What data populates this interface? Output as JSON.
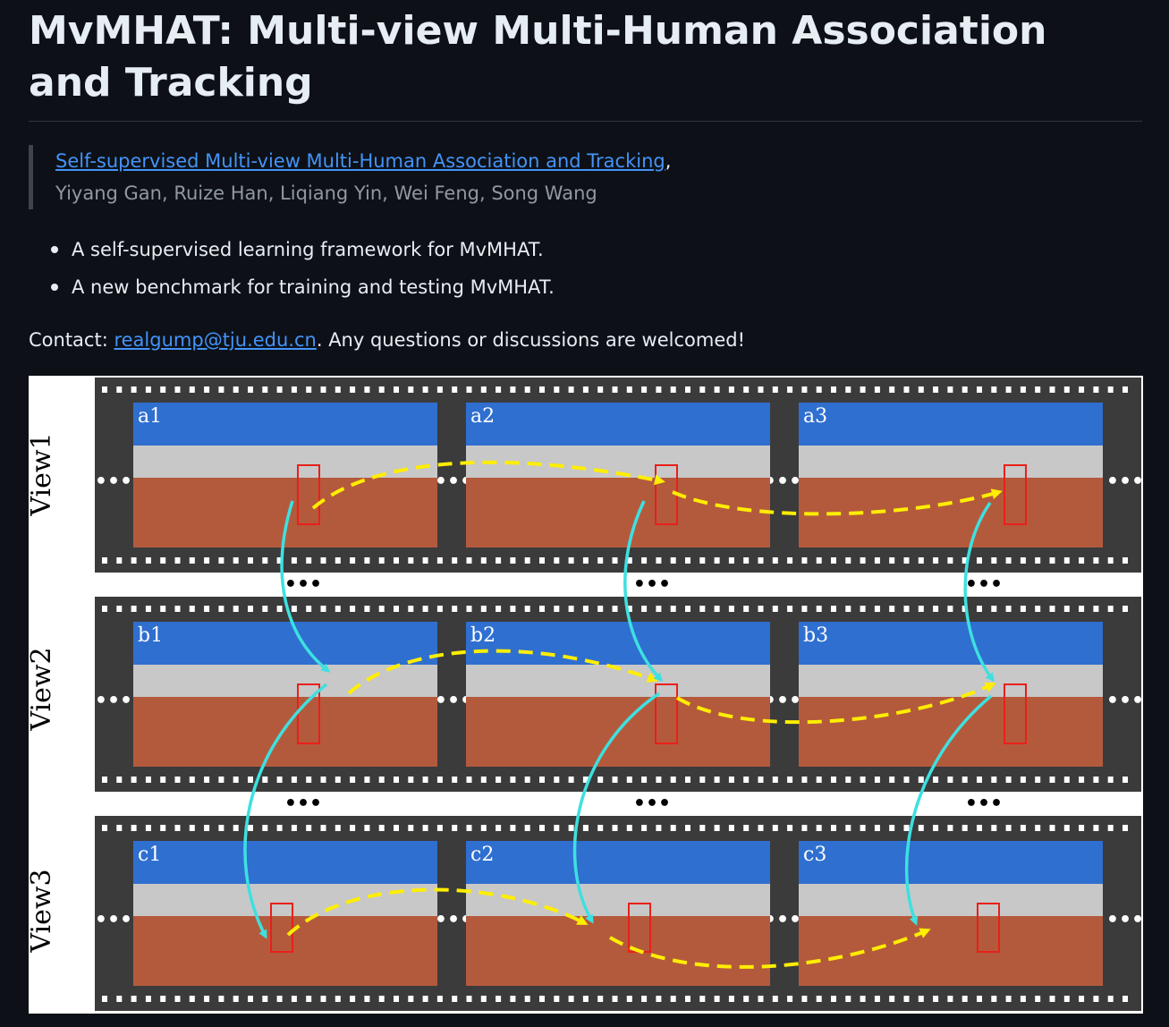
{
  "header": {
    "title": "MvMHAT: Multi-view Multi-Human Association and Tracking"
  },
  "paper": {
    "link_text": "Self-supervised Multi-view Multi-Human Association and Tracking",
    "link_suffix": ",",
    "authors": "Yiyang Gan, Ruize Han, Liqiang Yin, Wei Feng, Song Wang"
  },
  "features": [
    "A self-supervised learning framework for MvMHAT.",
    "A new benchmark for training and testing MvMHAT."
  ],
  "contact": {
    "prefix": "Contact: ",
    "email": "realgump@tju.edu.cn",
    "suffix": ". Any questions or discussions are welcomed!"
  },
  "figure": {
    "views": [
      "View1",
      "View2",
      "View3"
    ],
    "frames": [
      [
        "a1",
        "a2",
        "a3"
      ],
      [
        "b1",
        "b2",
        "b3"
      ],
      [
        "c1",
        "c2",
        "c3"
      ]
    ],
    "ellipsis": "•••",
    "colors": {
      "film": "#3b3b3b",
      "perforation": "#ffffff",
      "sky": "#2f6fd0",
      "building": "#c8c8c8",
      "ground": "#b45a3c",
      "box": "#e8201a",
      "cross_view_arrow": "#3ee0e0",
      "temporal_arrow": "#ffee00"
    }
  }
}
